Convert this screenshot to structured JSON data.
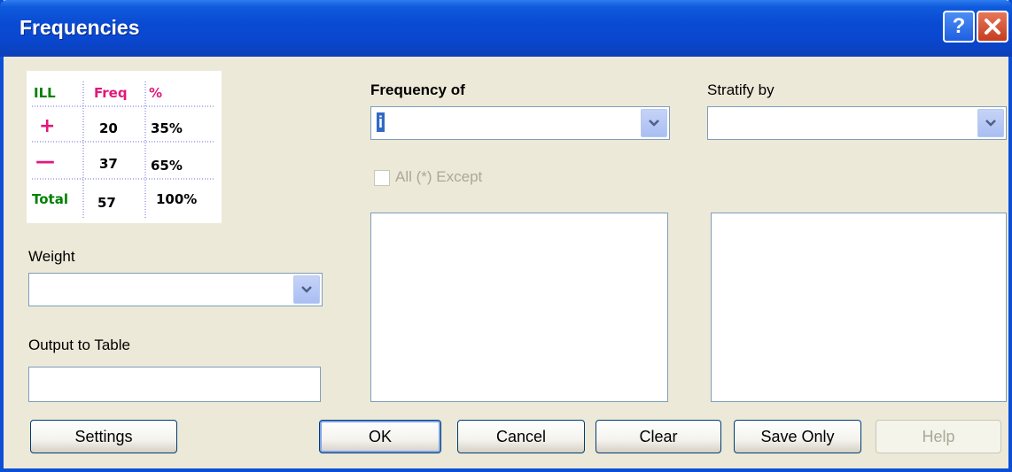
{
  "window": {
    "title": "Frequencies"
  },
  "titlebar_buttons": {
    "help": "?",
    "close_icon": "close-icon"
  },
  "legend_image": {
    "header": {
      "ill": "ILL",
      "freq": "Freq",
      "pct": "%"
    },
    "rows": [
      {
        "sign": "+",
        "freq": "20",
        "pct": "35%"
      },
      {
        "sign": "—",
        "freq": "37",
        "pct": "65%"
      },
      {
        "sign": "Total",
        "freq": "57",
        "pct": "100%"
      }
    ],
    "colors": {
      "ill": "#008000",
      "freq": "#E0197C",
      "plus_minus": "#E0197C",
      "total": "#008000"
    }
  },
  "weight": {
    "label": "Weight",
    "value": ""
  },
  "output_table": {
    "label": "Output to Table",
    "value": ""
  },
  "frequency_of": {
    "label": "Frequency of",
    "value": "i"
  },
  "stratify_by": {
    "label": "Stratify by",
    "value": ""
  },
  "all_except": {
    "label": "All (*) Except",
    "checked": false,
    "enabled": false
  },
  "buttons": {
    "settings": "Settings",
    "ok": "OK",
    "cancel": "Cancel",
    "clear": "Clear",
    "save_only": "Save Only",
    "help": "Help"
  }
}
